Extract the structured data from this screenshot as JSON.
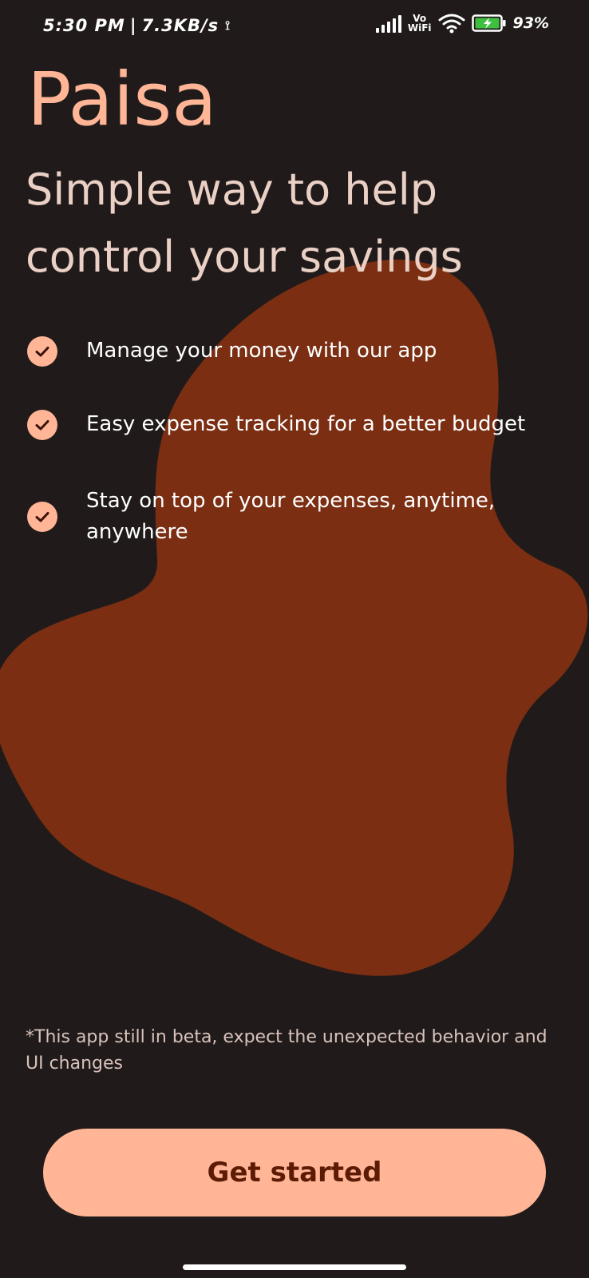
{
  "status_bar": {
    "time": "5:30 PM",
    "separator": "|",
    "network_speed": "7.3KB/s",
    "cast_icon": "cast-icon",
    "signal_icon": "signal-icon",
    "vowifi_top": "Vo",
    "vowifi_bottom": "WiFi",
    "wifi_icon": "wifi-icon",
    "battery_icon": "battery-charging-icon",
    "battery_percent": "93%"
  },
  "app": {
    "title": "Paisa",
    "tagline": "Simple way to help control your savings",
    "features": [
      {
        "icon": "check-circle-icon",
        "text": "Manage your money with our app"
      },
      {
        "icon": "check-circle-icon",
        "text": "Easy expense tracking for a better budget"
      },
      {
        "icon": "check-circle-icon",
        "text": "Stay on top of your expenses, anytime, anywhere"
      }
    ],
    "disclaimer": "*This app still in beta, expect the unexpected behavior and UI changes",
    "cta_label": "Get started"
  },
  "colors": {
    "background": "#201b1a",
    "blob": "#7b2e12",
    "accent": "#ffb596",
    "tagline": "#ead0c5",
    "button_text": "#5c1b04"
  }
}
